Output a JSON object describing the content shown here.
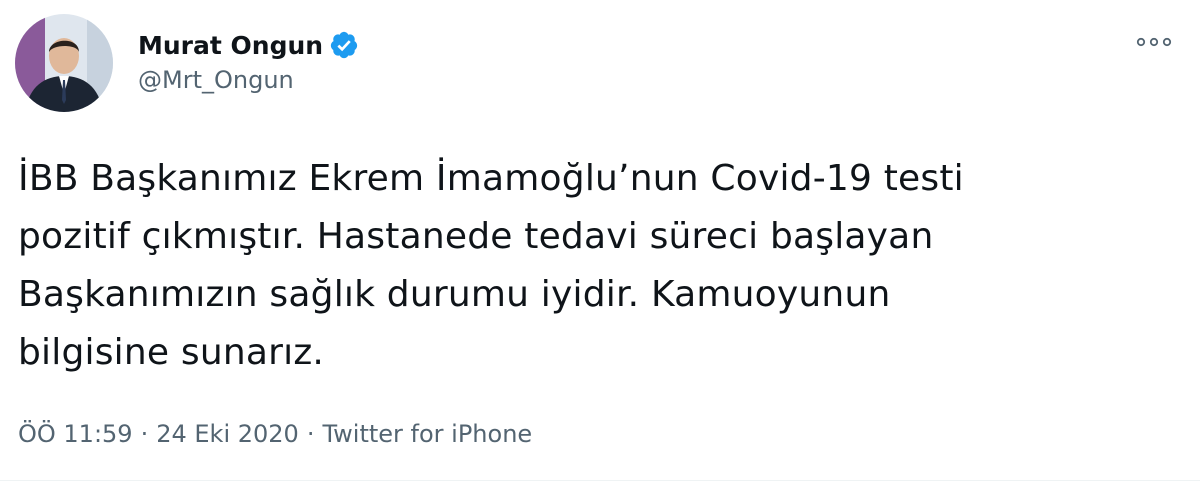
{
  "author": {
    "display_name": "Murat Ongun",
    "handle": "@Mrt_Ongun",
    "verified": true
  },
  "tweet": {
    "lines": [
      "İBB Başkanımız Ekrem İmamoğlu’nun Covid-19 testi",
      "pozitif çıkmıştır. Hastanede tedavi süreci başlayan",
      "Başkanımızın sağlık durumu iyidir. Kamuoyunun",
      "bilgisine sunarız."
    ]
  },
  "meta": {
    "time": "ÖÖ 11:59",
    "separator": "·",
    "date": "24 Eki 2020",
    "source": "Twitter for iPhone"
  },
  "icons": {
    "verified": "verified-badge-icon",
    "more": "more-options-icon"
  },
  "colors": {
    "text": "#0f1419",
    "secondary": "#536471",
    "verified": "#1d9bf0"
  }
}
